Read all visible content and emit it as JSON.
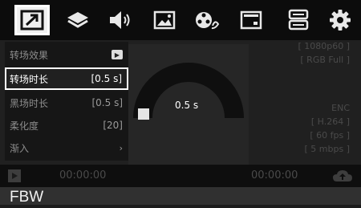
{
  "toolbar": {
    "icons": [
      "transition-icon",
      "layers-icon",
      "volume-icon",
      "image-icon",
      "film-reel-icon",
      "window-icon",
      "storage-icon",
      "gear-icon"
    ]
  },
  "menu": {
    "items": [
      {
        "label": "转场效果",
        "value": ""
      },
      {
        "label": "转场时长",
        "value": "[0.5 s]"
      },
      {
        "label": "黑场时长",
        "value": "[0.5 s]"
      },
      {
        "label": "柔化度",
        "value": "[20]"
      },
      {
        "label": "渐入",
        "value": "›"
      }
    ]
  },
  "preview": {
    "dial_value": "0.5 s"
  },
  "info": {
    "resolution": "[ 1080p60 ]",
    "color": "[ RGB Full ]",
    "enc_label": "ENC",
    "codec": "[ H.264 ]",
    "fps": "[ 60 fps ]",
    "bitrate": "[ 5 mbps ]"
  },
  "status": {
    "left_timecode": "00:00:00",
    "right_timecode": "00:00:00"
  },
  "bottom": {
    "label": "FBW"
  },
  "colors": {
    "toolbar_bg": "#0c0c0c",
    "active_tab_bg": "#f0f0f0",
    "dial_arc": "#111111"
  }
}
